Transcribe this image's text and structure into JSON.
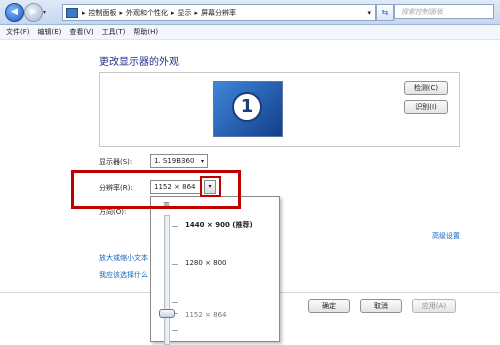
{
  "titlebar": {
    "back_icon": "back-arrow-icon",
    "forward_icon": "forward-arrow-icon",
    "address": {
      "icon": "computer-icon",
      "crumbs": [
        "控制面板",
        "外观和个性化",
        "显示",
        "屏幕分辨率"
      ]
    },
    "search_placeholder": "搜索控制面板"
  },
  "menu": [
    "文件(F)",
    "编辑(E)",
    "查看(V)",
    "工具(T)",
    "帮助(H)"
  ],
  "page": {
    "title": "更改显示器的外观",
    "monitor_number": "1",
    "detect_button": "检测(C)",
    "identify_button": "识别(I)",
    "display_label": "显示器(S):",
    "display_value": "1. S19B360",
    "resolution_label": "分辨率(R):",
    "resolution_value": "1152 × 864",
    "orientation_label": "方向(O):",
    "advanced_link": "高级设置",
    "link1": "放大或缩小文本",
    "link2": "我应该选择什么",
    "ok_button": "确定",
    "cancel_button": "取消",
    "apply_button": "应用(A)"
  },
  "dropdown": {
    "high_label": "高",
    "options": [
      "1440 × 900 (推荐)",
      "1280 × 800",
      "1152 × 864"
    ],
    "selected": "1152 × 864"
  },
  "colors": {
    "highlight": "#c00000",
    "link": "#1464c0",
    "title": "#1e3287"
  }
}
